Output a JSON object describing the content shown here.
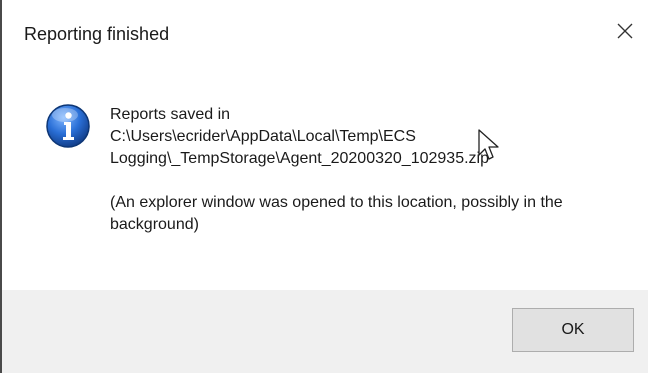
{
  "dialog": {
    "title": "Reporting finished",
    "close_icon": "close-icon",
    "icon": "info-icon",
    "message": {
      "line1": "Reports saved in",
      "line2": "C:\\Users\\ecrider\\AppData\\Local\\Temp\\ECS",
      "line3": "Logging\\_TempStorage\\Agent_20200320_102935.zip",
      "paragraph2": "(An explorer window was opened to this location, possibly in the background)"
    },
    "ok_label": "OK"
  },
  "colors": {
    "footer_bg": "#f0f0f0",
    "button_bg": "#e1e1e1",
    "button_border": "#adadad",
    "icon_blue": "#1f5fbf"
  }
}
